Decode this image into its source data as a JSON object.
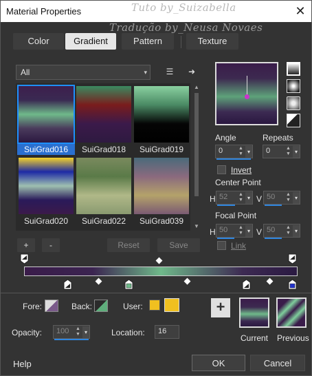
{
  "window": {
    "title": "Material Properties",
    "watermark_line1": "Tuto by_Suizabella",
    "watermark_line2": "Tradução by_Neusa Novaes",
    "close_glyph": "✕"
  },
  "tabs": [
    {
      "label": "Color",
      "active": false
    },
    {
      "label": "Gradient",
      "active": true
    },
    {
      "label": "Pattern",
      "active": false
    },
    {
      "label": "Texture",
      "active": false
    }
  ],
  "library": {
    "category": "All",
    "category_arrow": "▾",
    "manage_icon": "list-icon",
    "manage_glyph": "☰",
    "more_icon": "arrow-right-icon",
    "more_glyph": "➜",
    "gradients": [
      {
        "name": "SuiGrad016",
        "selected": true,
        "colors": [
          "#3d1f4d",
          "#3a2a52",
          "#6fb98a",
          "#4a3b5c",
          "#2b1840"
        ]
      },
      {
        "name": "SuiGrad018",
        "selected": false,
        "colors": [
          "#3a8a60",
          "#7a1c1c",
          "#3b1a4a",
          "#2e1a40"
        ]
      },
      {
        "name": "SuiGrad019",
        "selected": false,
        "colors": [
          "#8ad0a0",
          "#4a8a64",
          "#050505",
          "#000000"
        ]
      },
      {
        "name": "SuiGrad020",
        "selected": false,
        "colors": [
          "#f5d22a",
          "#1d2aa5",
          "#9fc0b0",
          "#2a1a5a",
          "#3b1a4a"
        ]
      },
      {
        "name": "SuiGrad022",
        "selected": false,
        "colors": [
          "#7a8a5e",
          "#5a7a48",
          "#b0b888",
          "#8a9a70"
        ]
      },
      {
        "name": "SuiGrad039",
        "selected": false,
        "colors": [
          "#4a6a7a",
          "#8a6a7e",
          "#b4a26a",
          "#7a5a72"
        ]
      }
    ],
    "scroll_up": "▲",
    "scroll_down": "▼"
  },
  "actions": {
    "add": "+",
    "remove": "-",
    "reset": "Reset",
    "save": "Save"
  },
  "preview": {
    "style_buttons": [
      "linear-icon",
      "rectangular-icon",
      "sunburst-icon",
      "radial-icon"
    ]
  },
  "angle": {
    "label": "Angle",
    "value": "0"
  },
  "repeats": {
    "label": "Repeats",
    "value": "0"
  },
  "invert": {
    "label": "Invert",
    "checked": false
  },
  "center_point": {
    "label": "Center Point",
    "h_label": "H",
    "h_value": "52",
    "v_label": "V",
    "v_value": "50"
  },
  "focal_point": {
    "label": "Focal Point",
    "h_label": "H",
    "h_value": "50",
    "v_label": "V",
    "v_value": "50"
  },
  "link": {
    "label": "Link",
    "checked": false
  },
  "gradient_bar": {
    "colors": [
      "#3a1c4a",
      "#3b2450",
      "#6fb98a",
      "#3d2a52",
      "#2b1a42"
    ]
  },
  "bottom": {
    "fore_label": "Fore:",
    "back_label": "Back:",
    "user_label": "User:",
    "fore_color": "#7a5a8a",
    "back_color": "#5fae7c",
    "user_color": "#f0c020",
    "opacity_label": "Opacity:",
    "opacity_value": "100",
    "location_label": "Location:",
    "location_value": "16",
    "add_glyph": "+",
    "current_label": "Current",
    "previous_label": "Previous"
  },
  "footer": {
    "help": "Help",
    "ok": "OK",
    "cancel": "Cancel"
  }
}
